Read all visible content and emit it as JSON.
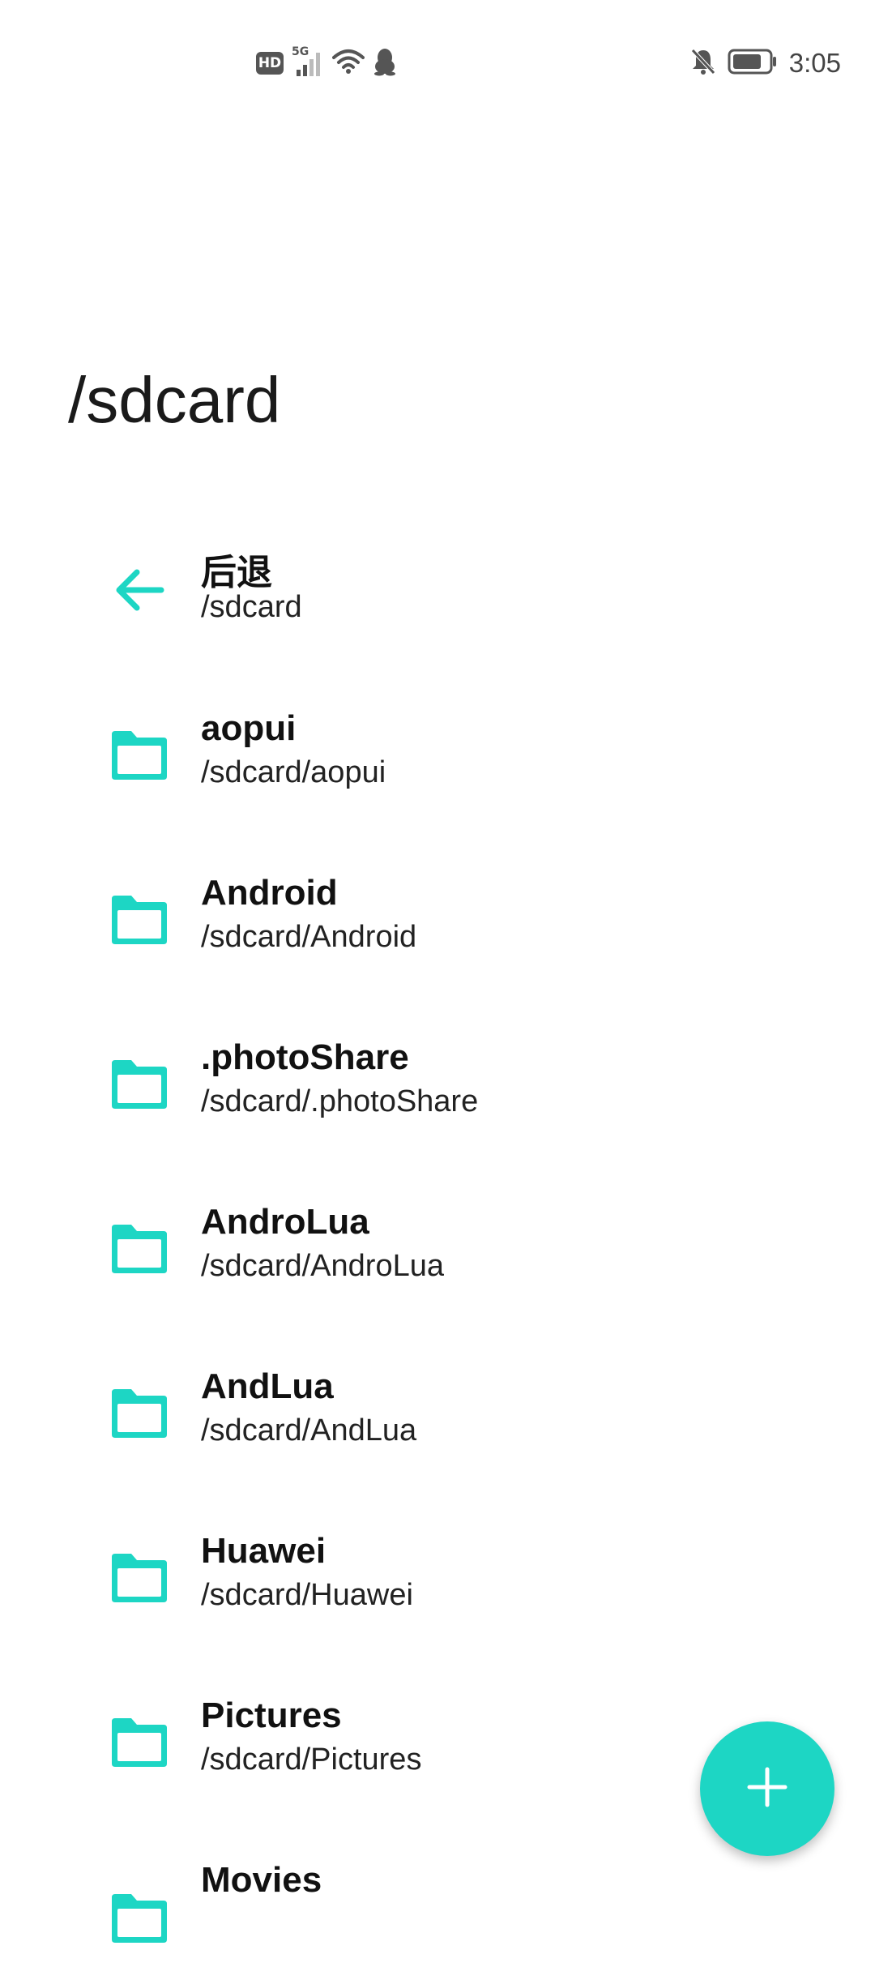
{
  "status_bar": {
    "hd_label": "HD",
    "network_label": "5G",
    "time": "3:05",
    "icons": [
      "hd-icon",
      "signal-5g-icon",
      "wifi-icon",
      "qq-penguin-icon",
      "bell-off-icon",
      "battery-icon"
    ]
  },
  "page_title": "/sdcard",
  "accent_color": "#1dd6c4",
  "back_item": {
    "label": "后退",
    "path": "/sdcard",
    "icon": "arrow-back-icon"
  },
  "folders": [
    {
      "name": "aopui",
      "path": "/sdcard/aopui"
    },
    {
      "name": "Android",
      "path": "/sdcard/Android"
    },
    {
      "name": ".photoShare",
      "path": "/sdcard/.photoShare"
    },
    {
      "name": "AndroLua",
      "path": "/sdcard/AndroLua"
    },
    {
      "name": "AndLua",
      "path": "/sdcard/AndLua"
    },
    {
      "name": "Huawei",
      "path": "/sdcard/Huawei"
    },
    {
      "name": "Pictures",
      "path": "/sdcard/Pictures"
    },
    {
      "name": "Movies",
      "path": ""
    }
  ],
  "fab": {
    "icon": "plus-icon"
  }
}
